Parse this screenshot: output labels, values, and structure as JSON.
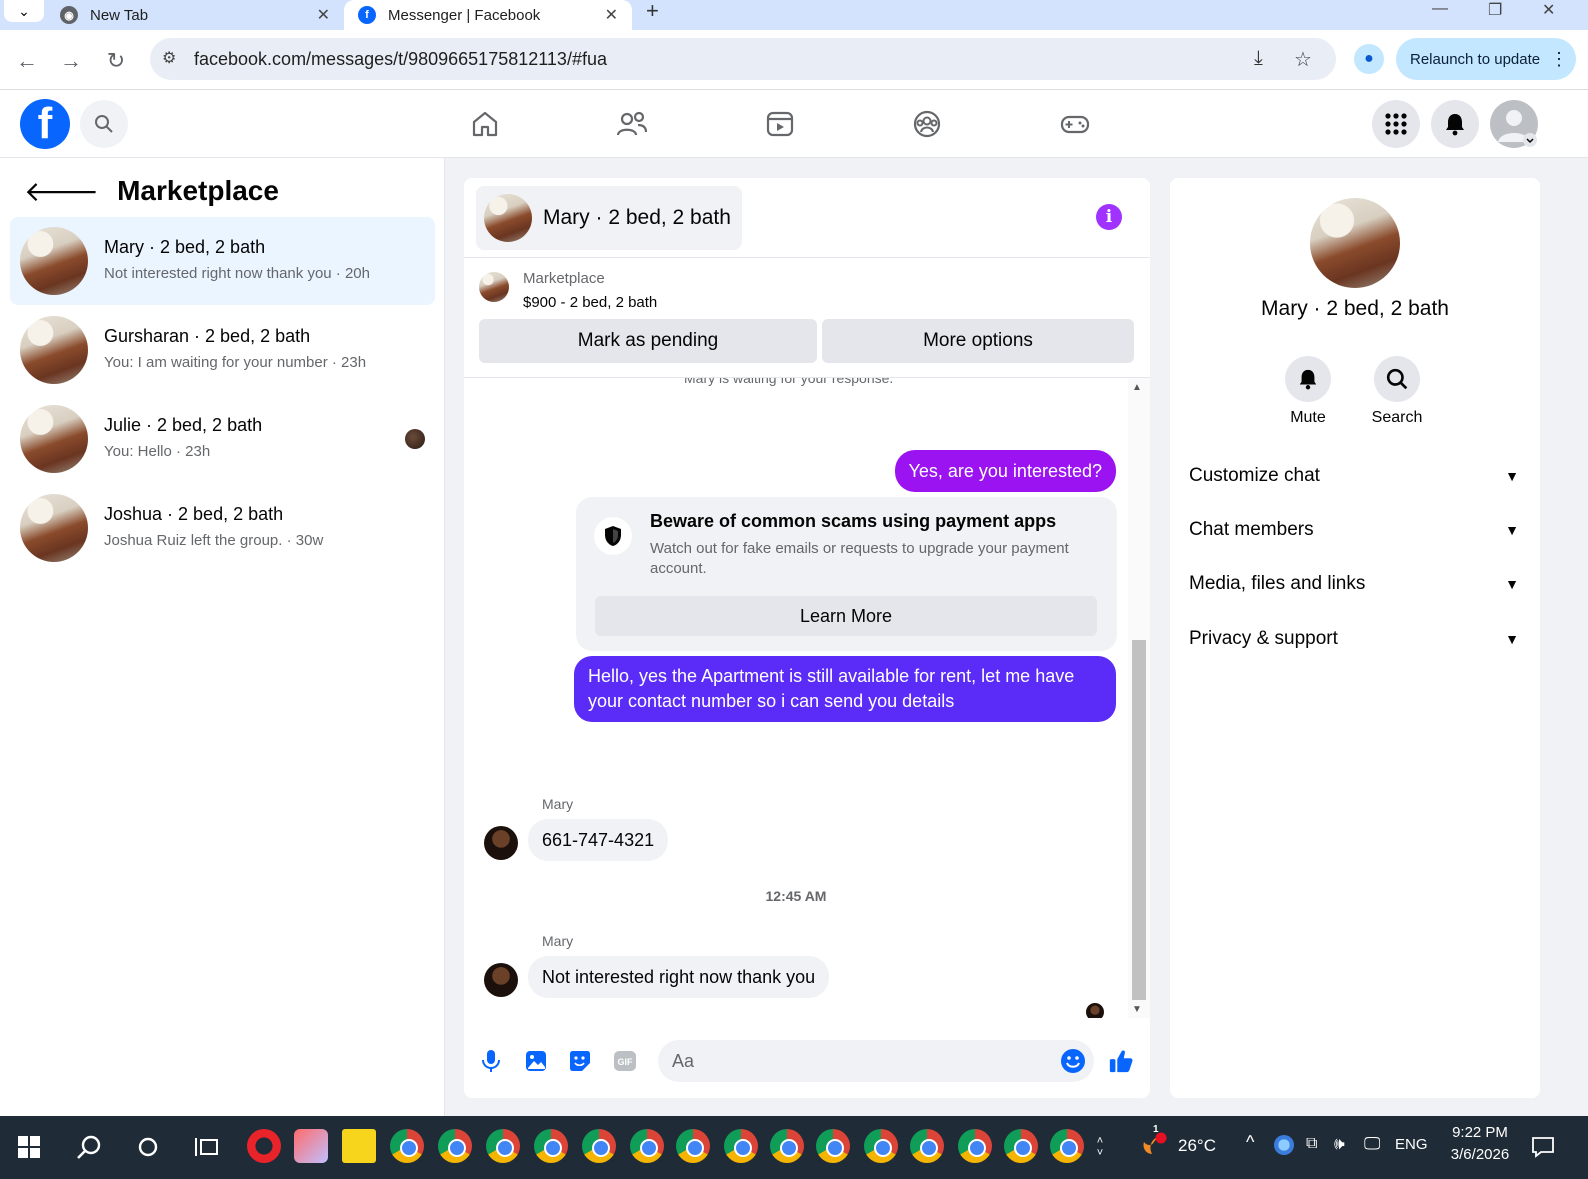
{
  "browser": {
    "tabs": [
      {
        "title": "New Tab",
        "active": false
      },
      {
        "title": "Messenger | Facebook",
        "active": true
      }
    ],
    "url": "facebook.com/messages/t/9809665175812113/#fua",
    "relaunch_label": "Relaunch to update"
  },
  "sidebar": {
    "title": "Marketplace",
    "conversations": [
      {
        "name": "Mary · 2 bed, 2 bath",
        "preview": "Not interested right now thank you · 20h",
        "active": true
      },
      {
        "name": "Gursharan · 2 bed, 2 bath",
        "preview": "You: I am waiting for your number · 23h",
        "active": false
      },
      {
        "name": "Julie · 2 bed, 2 bath",
        "preview": "You: Hello · 23h",
        "active": false
      },
      {
        "name": "Joshua · 2 bed, 2 bath",
        "preview": "Joshua Ruiz left the group. · 30w",
        "active": false
      }
    ]
  },
  "chat": {
    "title": "Mary · 2 bed, 2 bath",
    "listing": {
      "category": "Marketplace",
      "price_line": "$900 - 2 bed, 2 bath",
      "mark_pending_label": "Mark as pending",
      "more_options_label": "More options"
    },
    "status_text": "Mary is waiting for your response.",
    "messages": {
      "out1": "Yes, are you interested?",
      "scam_title": "Beware of common scams using payment apps",
      "scam_body": "Watch out for fake emails or requests to upgrade your payment account.",
      "learn_more": "Learn More",
      "out2": "Hello, yes the Apartment is still available for rent, let me have your contact number so i can send you details",
      "sender1": "Mary",
      "in1": "661-747-4321",
      "timestamp": "12:45 AM",
      "sender2": "Mary",
      "in2": "Not interested right now thank you"
    },
    "composer_placeholder": "Aa"
  },
  "details": {
    "name": "Mary · 2 bed, 2 bath",
    "actions": {
      "mute": "Mute",
      "search": "Search"
    },
    "sections": [
      "Customize chat",
      "Chat members",
      "Media, files and links",
      "Privacy & support"
    ]
  },
  "taskbar": {
    "weather": "26°C",
    "weather_badge": "1",
    "language": "ENG",
    "time": "9:22 PM",
    "date": "3/6/2026"
  },
  "colors": {
    "facebook_blue": "#0866ff",
    "outgoing_bubble": "#5b2cf7",
    "active_conversation": "#ebf5ff"
  }
}
